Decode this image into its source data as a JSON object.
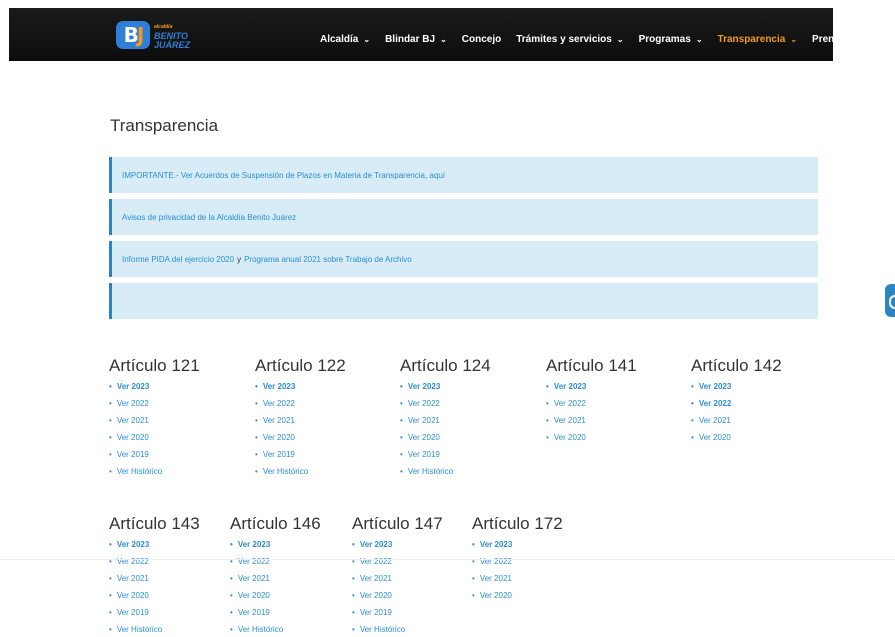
{
  "header": {
    "logo": {
      "badge": "BJ",
      "small": "alcaldía",
      "line1": "BENITO",
      "line2": "JUÁREZ"
    },
    "nav": [
      {
        "label": "Alcaldía",
        "chevron": "⌄",
        "active": false
      },
      {
        "label": "Blindar BJ",
        "chevron": "⌄",
        "active": false
      },
      {
        "label": "Concejo",
        "chevron": "",
        "active": false
      },
      {
        "label": "Trámites y servicios",
        "chevron": "⌄",
        "active": false
      },
      {
        "label": "Programas",
        "chevron": "⌄",
        "active": false
      },
      {
        "label": "Transparencia",
        "chevron": "⌄",
        "active": true
      },
      {
        "label": "Prensa",
        "chevron": "",
        "active": false
      }
    ]
  },
  "page": {
    "title": "Transparencia"
  },
  "notices": {
    "n1": "IMPORTANTE.- Ver Acuerdos de Suspensión de Plazos en Materia de Transparencia, aquí",
    "n2": "Avisos de privacidad de la Alcaldía Benito Juárez",
    "n3a": "Informe PIDA del ejercicio 2020",
    "n3b": "y",
    "n3c": "Programa anual 2021 sobre Trabajo de Archivo",
    "n4": ""
  },
  "articles": {
    "a121": {
      "title": "Artículo 121",
      "links": [
        "Ver 2023",
        "Ver 2022",
        "Ver 2021",
        "Ver 2020",
        "Ver 2019",
        "Ver Histórico"
      ]
    },
    "a122": {
      "title": "Artículo 122",
      "links": [
        "Ver 2023",
        "Ver 2022",
        "Ver 2021",
        "Ver 2020",
        "Ver 2019",
        "Ver Histórico"
      ]
    },
    "a124": {
      "title": "Artículo 124",
      "links": [
        "Ver 2023",
        "Ver 2022",
        "Ver 2021",
        "Ver 2020",
        "Ver 2019",
        "Ver Histórico"
      ]
    },
    "a141": {
      "title": "Artículo 141",
      "links": [
        "Ver 2023",
        "Ver 2022",
        "Ver 2021",
        "Ver 2020"
      ]
    },
    "a142": {
      "title": "Artículo 142",
      "links": [
        "Ver 2023",
        "Ver 2022",
        "Ver 2021",
        "Ver 2020"
      ]
    },
    "a143": {
      "title": "Artículo 143",
      "links": [
        "Ver 2023",
        "Ver 2022",
        "Ver 2021",
        "Ver 2020",
        "Ver 2019",
        "Ver Histórico"
      ]
    },
    "a146": {
      "title": "Artículo 146",
      "links": [
        "Ver 2023",
        "Ver 2022",
        "Ver 2021",
        "Ver 2020",
        "Ver 2019",
        "Ver Histórico"
      ]
    },
    "a147": {
      "title": "Artículo 147",
      "links": [
        "Ver 2023",
        "Ver 2022",
        "Ver 2021",
        "Ver 2020",
        "Ver 2019",
        "Ver Histórico"
      ]
    },
    "a172": {
      "title": "Artículo 172",
      "links": [
        "Ver 2023",
        "Ver 2022",
        "Ver 2021",
        "Ver 2020"
      ]
    }
  },
  "colors": {
    "accent": "#f39a1e",
    "link": "#2a8dd4",
    "notice_bg": "#d7ecf6",
    "notice_border": "#2c84c4",
    "header_bg": "#111111"
  }
}
